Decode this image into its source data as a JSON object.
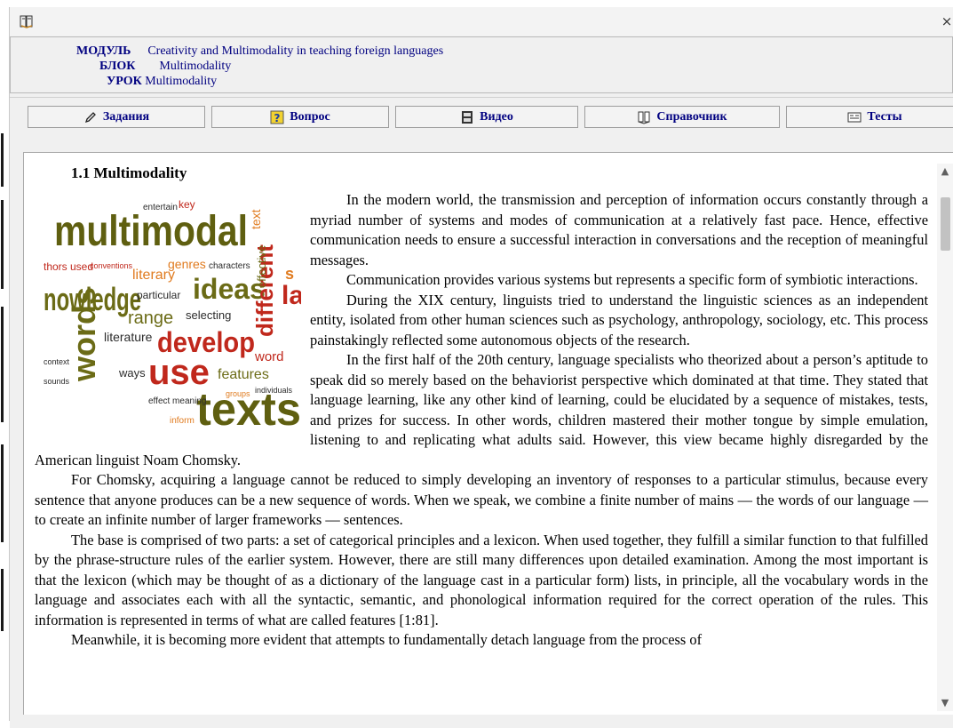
{
  "window": {
    "close_glyph": "×"
  },
  "header": {
    "module_label": "МОДУЛЬ",
    "module_value": "Creativity and Multimodality in teaching foreign languages",
    "block_label": "БЛОК",
    "block_value": "Multimodality",
    "lesson_label": "УРОК",
    "lesson_value": "Multimodality"
  },
  "toolbar": {
    "buttons": [
      {
        "label": "Задания",
        "icon": "pencil-icon"
      },
      {
        "label": "Вопрос",
        "icon": "help-question-icon"
      },
      {
        "label": "Видео",
        "icon": "film-icon"
      },
      {
        "label": "Справочник",
        "icon": "book-icon"
      },
      {
        "label": "Тесты",
        "icon": "test-card-icon"
      }
    ]
  },
  "article": {
    "heading": "1.1 Multimodality",
    "image_alt": "multimodal word cloud",
    "paragraphs": [
      "In the modern world, the transmission and perception of information occurs constantly through a myriad number of systems and modes of communication at a relatively fast pace. Hence, effective communication needs to ensure a successful interaction in conversations and the reception of meaningful messages.",
      "Communication provides various systems but represents a specific form of symbiotic interactions.",
      "During the XIX century, linguists tried to understand the linguistic sciences as an independent entity, isolated from other human sciences such as psychology, anthropology, sociology, etc. This process painstakingly reflected some autonomous objects of the research.",
      "In the first half of the 20th century, language specialists who theorized about a person’s aptitude to speak did so merely based on the behaviorist perspective which dominated at that time. They stated that language learning, like any other kind of learning, could be elucidated by a sequence of mistakes, tests, and prizes for success. In other words, children mastered their mother tongue by simple emulation, listening to and replicating what adults said. However, this view became highly disregarded by the American linguist Noam Chomsky.",
      "For Chomsky, acquiring a language cannot be reduced to simply developing an inventory of responses to a particular stimulus, because every sentence that anyone produces can be a new sequence of words. When we speak, we combine a finite number of mains — the words of our language — to create an infinite number of larger frameworks — sentences.",
      "The base is comprised of two parts: a set of categorical principles and a lexicon. When used together, they fulfill a similar function to that fulfilled by the phrase-structure rules of the earlier system. However, there are still many differences upon detailed examination. Among the most important is that the lexicon (which may be thought of as a dictionary of the language cast in a particular form) lists, in principle, all the vocabulary words in the language and associates each with all the syntactic, semantic, and phonological information required for the correct operation of the rules. This information is represented in terms of what are called features [1:81].",
      "Meanwhile, it is becoming more evident that attempts to fundamentally detach language from the process of"
    ],
    "wordcloud": {
      "multimodal": "multimodal",
      "knowledge": "nowledge",
      "ideas": "ideas",
      "words": "words",
      "develop": "develop",
      "use": "use",
      "texts": "texts",
      "different": "different",
      "literary": "literary",
      "range": "range",
      "genres": "genres",
      "authors_used": "thors used",
      "literature": "literature",
      "particular": "particular",
      "selecting": "selecting",
      "features": "features",
      "word": "word",
      "ways": "ways",
      "effective": "effective",
      "characters": "characters",
      "key": "key",
      "text": "text",
      "entertain": "entertain",
      "conventions": "conventions",
      "effect_meaning": "effect meaning",
      "inform": "inform",
      "context": "context",
      "sounds": "sounds",
      "individuals": "individuals",
      "groups": "groups",
      "la": "la",
      "s": "s"
    }
  },
  "colors": {
    "header_text": "#000080",
    "cloud_olive": "#6b6b16",
    "cloud_orange": "#e07b1f",
    "cloud_red": "#c0281c",
    "cloud_dark": "#2b2b2b",
    "cloud_yellow": "#d8b22a"
  }
}
